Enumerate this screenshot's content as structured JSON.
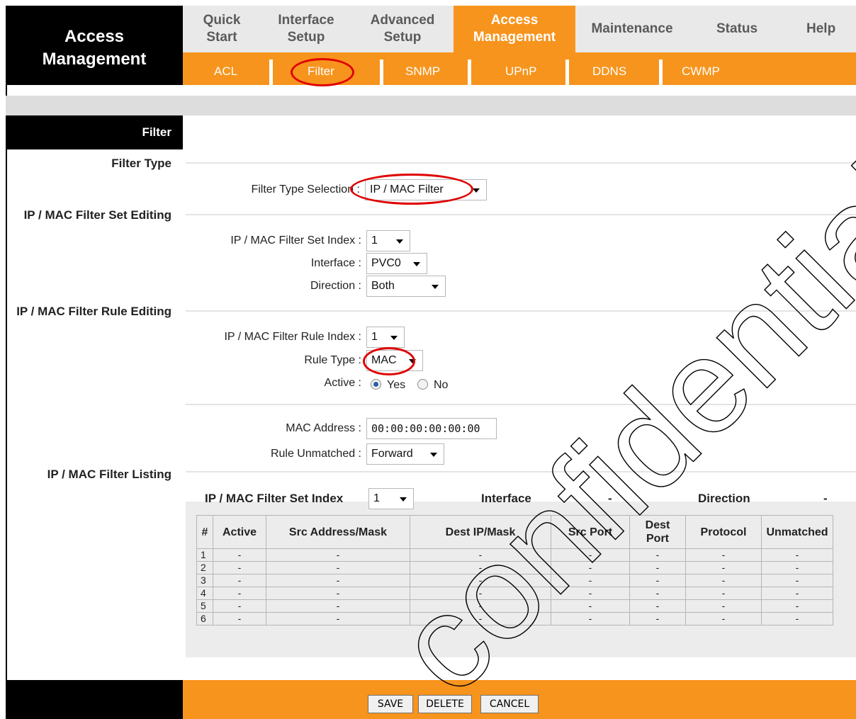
{
  "brand": {
    "title": "Access\nManagement"
  },
  "nav": {
    "tabs": [
      {
        "label": "Quick\nStart"
      },
      {
        "label": "Interface\nSetup"
      },
      {
        "label": "Advanced\nSetup"
      },
      {
        "label": "Access\nManagement"
      },
      {
        "label": "Maintenance"
      },
      {
        "label": "Status"
      },
      {
        "label": "Help"
      }
    ],
    "subtabs": [
      {
        "label": "ACL"
      },
      {
        "label": "Filter"
      },
      {
        "label": "SNMP"
      },
      {
        "label": "UPnP"
      },
      {
        "label": "DDNS"
      },
      {
        "label": "CWMP"
      }
    ]
  },
  "sections": {
    "filter": "Filter",
    "filter_type": "Filter Type",
    "set_editing": "IP / MAC Filter Set Editing",
    "rule_editing": "IP / MAC Filter Rule Editing",
    "listing": "IP / MAC Filter Listing"
  },
  "form": {
    "filter_type_label": "Filter Type Selection :",
    "filter_type_value": "IP / MAC Filter",
    "set_index_label": "IP / MAC Filter Set Index :",
    "set_index_value": "1",
    "interface_label": "Interface :",
    "interface_value": "PVC0",
    "direction_label": "Direction :",
    "direction_value": "Both",
    "rule_index_label": "IP / MAC Filter Rule Index :",
    "rule_index_value": "1",
    "rule_type_label": "Rule Type :",
    "rule_type_value": "MAC",
    "active_label": "Active :",
    "active_yes": "Yes",
    "active_no": "No",
    "mac_label": "MAC Address :",
    "mac_value": "00:00:00:00:00:00",
    "unmatched_label": "Rule Unmatched :",
    "unmatched_value": "Forward"
  },
  "listing": {
    "set_index_label": "IP / MAC Filter Set Index",
    "set_index_value": "1",
    "interface_label": "Interface",
    "interface_value": "-",
    "direction_label": "Direction",
    "direction_value": "-",
    "columns": [
      "#",
      "Active",
      "Src Address/Mask",
      "Dest IP/Mask",
      "Src Port",
      "Dest\nPort",
      "Protocol",
      "Unmatched"
    ],
    "rows": [
      [
        "1",
        "-",
        "-",
        "-",
        "-",
        "-",
        "-",
        "-"
      ],
      [
        "2",
        "-",
        "-",
        "-",
        "-",
        "-",
        "-",
        "-"
      ],
      [
        "3",
        "-",
        "-",
        "-",
        "-",
        "-",
        "-",
        "-"
      ],
      [
        "4",
        "-",
        "-",
        "-",
        "-",
        "-",
        "-",
        "-"
      ],
      [
        "5",
        "-",
        "-",
        "-",
        "-",
        "-",
        "-",
        "-"
      ],
      [
        "6",
        "-",
        "-",
        "-",
        "-",
        "-",
        "-",
        "-"
      ]
    ]
  },
  "buttons": {
    "save": "SAVE",
    "delete": "DELETE",
    "cancel": "CANCEL"
  },
  "watermark": "confidential",
  "colors": {
    "accent": "#f7941d",
    "annotation": "#e00000"
  }
}
